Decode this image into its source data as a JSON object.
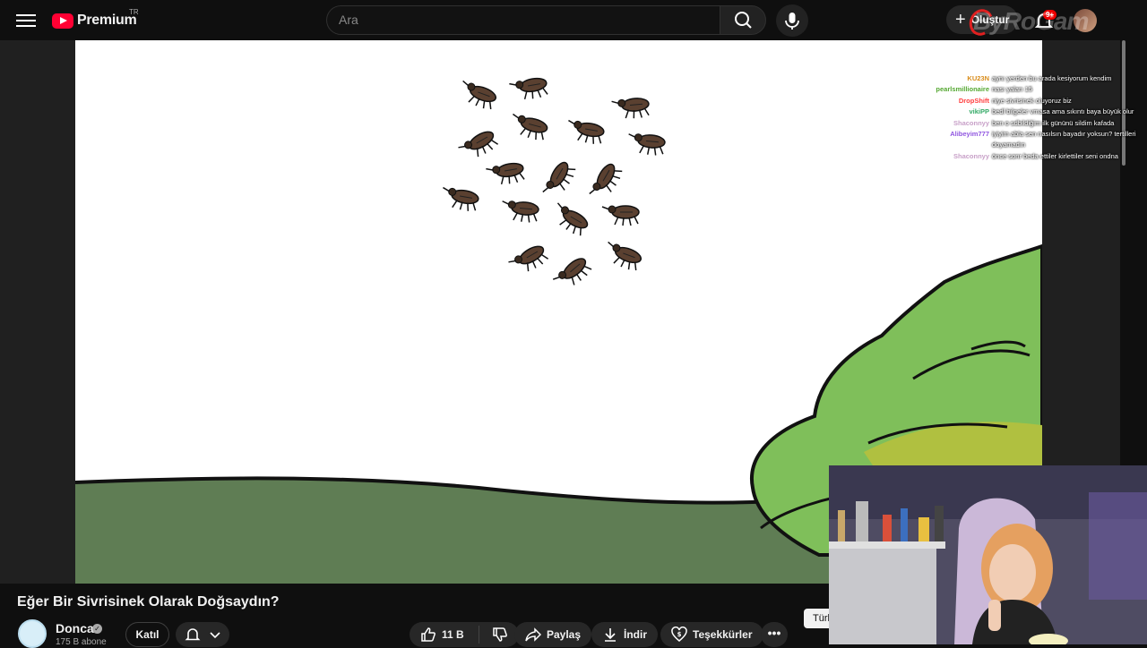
{
  "header": {
    "logo_text": "Premium",
    "logo_region": "TR",
    "search_placeholder": "Ara",
    "create_label": "Oluştur",
    "notification_count": "9+",
    "watermark": "ByRoGam"
  },
  "chat": [
    {
      "user": "KU23N",
      "color": "#d98c1a",
      "message": "aynı yerden bu arada kesiyorum kendim"
    },
    {
      "user": "pearlsmillionaire",
      "color": "#55a832",
      "message": "nası yaları 15"
    },
    {
      "user": "DropShift",
      "color": "#ff4040",
      "message": "niye sivrisinek oluyoruz biz"
    },
    {
      "user": "vikiPP",
      "color": "#33aa66",
      "message": "bedl bilgeler vmasa ama sıkıntı baya büyük olur"
    },
    {
      "user": "Shaconnyy",
      "color": "#c8a0c8",
      "message": "ben o sdbildiğim ilk gününü sildim kafada"
    },
    {
      "user": "Alibeyim777",
      "color": "#9055e0",
      "message": "iyiyim abla sen nasılsın bayadır yoksun? tertilleri doyamadın"
    },
    {
      "user": "Shaconnyy",
      "color": "#c8a0c8",
      "message": "önce sonr beda ettiler kirlettiler seni ondna"
    }
  ],
  "video": {
    "title": "Eğer Bir Sivrisinek Olarak Doğsaydın?",
    "channel": "Donca",
    "subscribers": "175 B abone",
    "join_label": "Katıl",
    "likes": "11 B",
    "share_label": "Paylaş",
    "download_label": "İndir",
    "thanks_label": "Teşekkürler",
    "more_label": "•••",
    "tooltip_label": "Türkçe"
  },
  "colors": {
    "accent": "#ff0033",
    "grass": "#5f7d54",
    "bush": "#7fbf5a",
    "bush_dark": "#b0c040",
    "bug": "#5a4030"
  },
  "icons": [
    "menu-icon",
    "search-icon",
    "mic-icon",
    "plus-icon",
    "bell-icon",
    "like-icon",
    "dislike-icon",
    "share-icon",
    "download-icon",
    "thanks-icon",
    "chevron-down-icon",
    "verified-icon"
  ]
}
